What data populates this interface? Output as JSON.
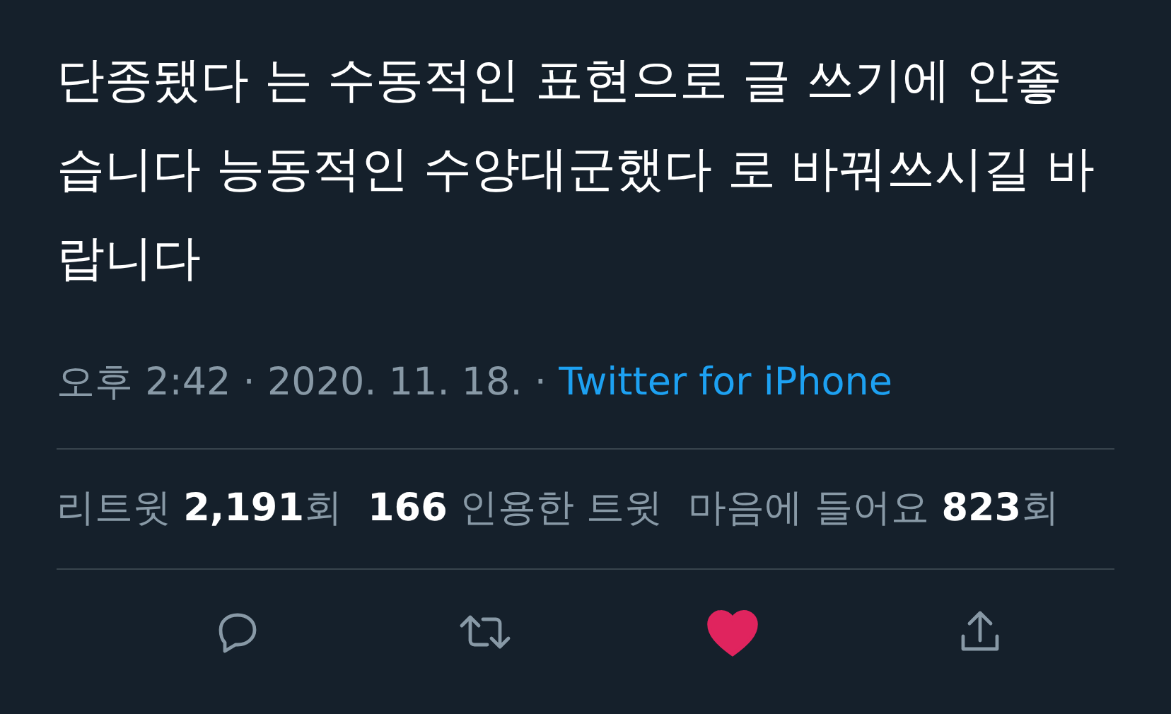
{
  "tweet": {
    "text": "단종됐다 는 수동적인 표현으로 글 쓰기에 안좋습니다 능동적인 수양대군했다 로 바꿔쓰시길 바랍니다",
    "timestamp": "오후 2:42 · 2020. 11. 18. · ",
    "source": "Twitter for iPhone"
  },
  "stats": [
    "리트윗 **2,191**회",
    "**166** 인용한 트윗",
    "마음에 들어요 **823**회"
  ],
  "actions": [
    {
      "kind": "reply"
    },
    {
      "kind": "retweet"
    },
    {
      "kind": "like",
      "liked": true
    },
    {
      "kind": "share"
    }
  ]
}
